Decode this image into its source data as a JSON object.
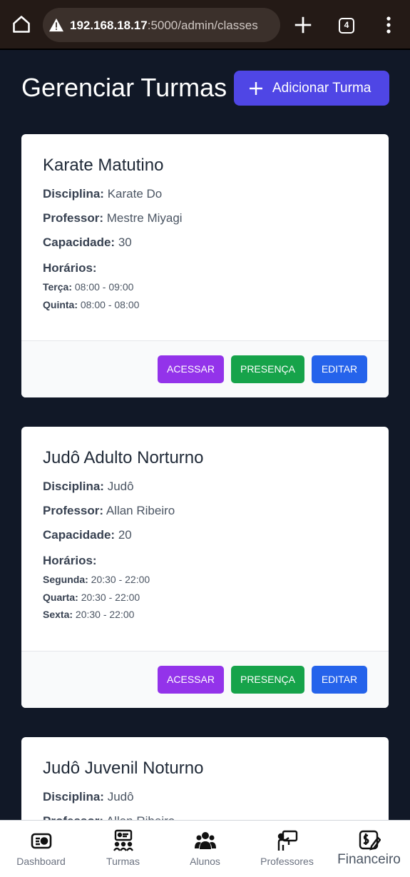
{
  "browser": {
    "url_host": "192.168.18.17",
    "url_path": ":5000/admin/classes",
    "tab_count": "4"
  },
  "header": {
    "title": "Gerenciar Turmas",
    "add_label": "Adicionar Turma"
  },
  "labels": {
    "discipline": "Disciplina:",
    "teacher": "Professor:",
    "capacity": "Capacidade:",
    "schedules": "Horários:",
    "access": "ACESSAR",
    "presence": "PRESENÇA",
    "edit": "EDITAR"
  },
  "classes": [
    {
      "name": "Karate Matutino",
      "discipline": "Karate Do",
      "teacher": "Mestre Miyagi",
      "capacity": "30",
      "schedule": [
        {
          "day": "Terça:",
          "time": "08:00 - 09:00"
        },
        {
          "day": "Quinta:",
          "time": "08:00 - 08:00"
        }
      ]
    },
    {
      "name": "Judô Adulto Norturno",
      "discipline": "Judô",
      "teacher": "Allan Ribeiro",
      "capacity": "20",
      "schedule": [
        {
          "day": "Segunda:",
          "time": "20:30 - 22:00"
        },
        {
          "day": "Quarta:",
          "time": "20:30 - 22:00"
        },
        {
          "day": "Sexta:",
          "time": "20:30 - 22:00"
        }
      ]
    },
    {
      "name": "Judô Juvenil Noturno",
      "discipline": "Judô",
      "teacher": "Allan Ribeiro"
    }
  ],
  "nav": [
    {
      "label": "Dashboard",
      "icon": "dashboard-icon"
    },
    {
      "label": "Turmas",
      "icon": "classes-icon"
    },
    {
      "label": "Alunos",
      "icon": "students-icon"
    },
    {
      "label": "Professores",
      "icon": "teachers-icon"
    },
    {
      "label": "Financeiro",
      "icon": "finance-icon"
    }
  ],
  "colors": {
    "page_bg": "#111827",
    "primary": "#4f46e5",
    "access": "#9333ea",
    "presence": "#16a34a",
    "edit": "#2563eb"
  }
}
